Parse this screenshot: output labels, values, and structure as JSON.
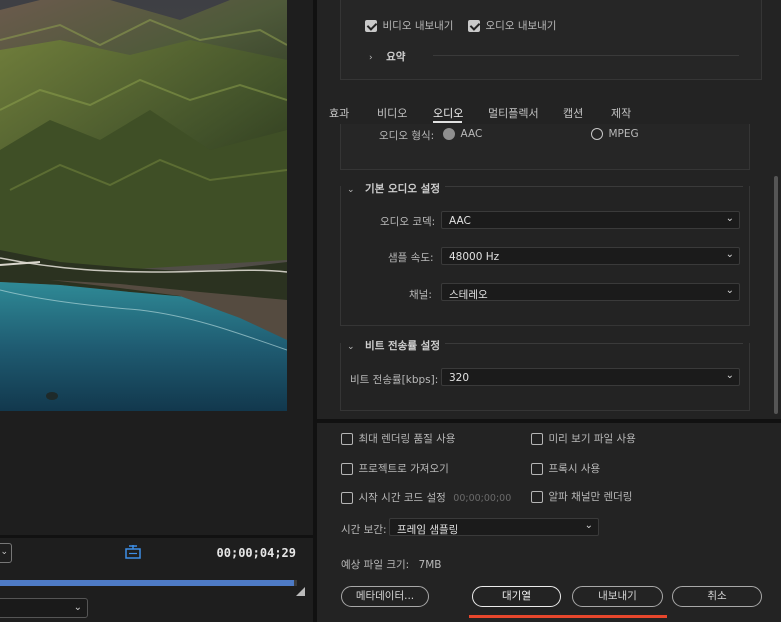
{
  "preview": {
    "timecode": "00;00;04;29",
    "scrub_progress": 0.99
  },
  "export_panel": {
    "export_video_label": "비디오 내보내기",
    "export_audio_label": "오디오 내보내기",
    "summary_label": "요약"
  },
  "tabs": [
    "효과",
    "비디오",
    "오디오",
    "멀티플렉서",
    "캡션",
    "제작"
  ],
  "active_tab": "오디오",
  "audio_format": {
    "label": "오디오 형식:",
    "options": [
      "AAC",
      "MPEG"
    ],
    "selected": "AAC"
  },
  "basic_audio": {
    "title": "기본 오디오 설정",
    "codec_label": "오디오 코덱:",
    "codec_value": "AAC",
    "sample_rate_label": "샘플 속도:",
    "sample_rate_value": "48000 Hz",
    "channels_label": "채널:",
    "channels_value": "스테레오"
  },
  "bitrate": {
    "title": "비트 전송률 설정",
    "label": "비트 전송률[kbps]:",
    "value": "320"
  },
  "options": {
    "max_render_quality": "최대 렌더링 품질 사용",
    "use_previews": "미리 보기 파일 사용",
    "import_into_project": "프로젝트로 가져오기",
    "use_proxies": "프록시 사용",
    "set_start_timecode": "시작 시간 코드 설정",
    "start_timecode_value": "00;00;00;00",
    "render_alpha_only": "알파 채널만 렌더링"
  },
  "time_interpolation": {
    "label": "시간 보간:",
    "value": "프레임 샘플링"
  },
  "file_size": {
    "label": "예상 파일 크기:",
    "value": "7MB"
  },
  "buttons": {
    "metadata": "메타데이터...",
    "queue": "대기열",
    "export": "내보내기",
    "cancel": "취소"
  },
  "colors": {
    "accent_blue": "#4e7bc6",
    "queue_underline": "#e6462c"
  }
}
